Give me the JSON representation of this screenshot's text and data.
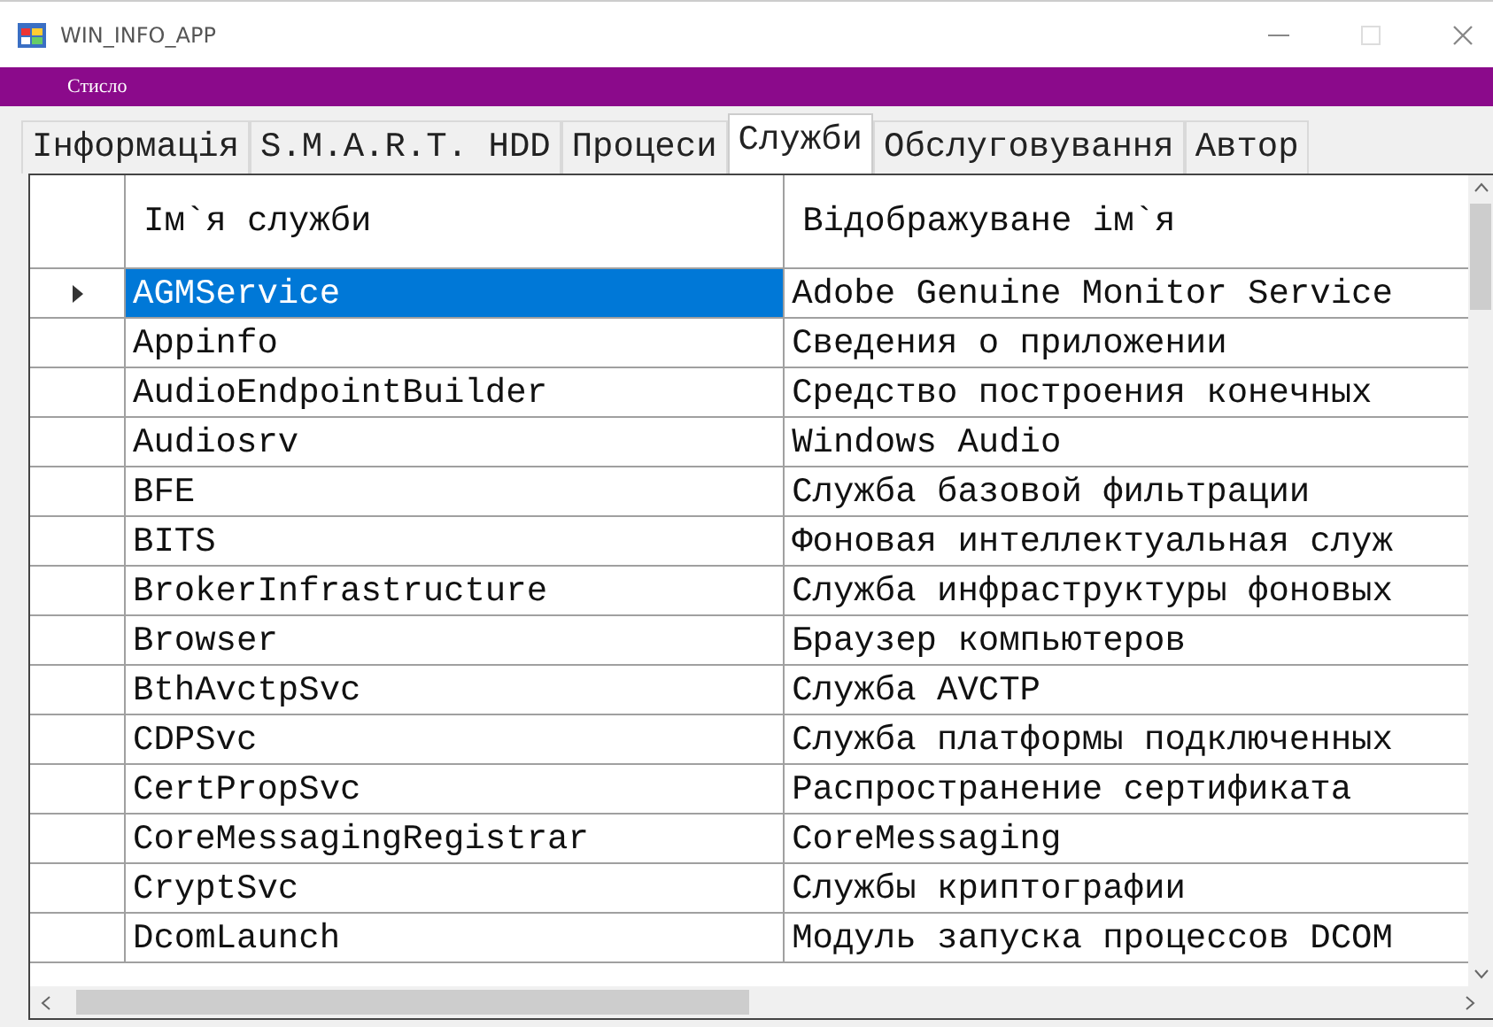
{
  "window": {
    "title": "WIN_INFO_APP"
  },
  "menu": [
    {
      "label": "Стисло"
    }
  ],
  "tabs": [
    {
      "label": "Інформація",
      "selected": false
    },
    {
      "label": "S.M.A.R.T. HDD",
      "selected": false
    },
    {
      "label": "Процеси",
      "selected": false
    },
    {
      "label": "Служби",
      "selected": true
    },
    {
      "label": "Обслуговування",
      "selected": false
    },
    {
      "label": "Автор",
      "selected": false
    }
  ],
  "table": {
    "columns": [
      "Ім`я служби",
      "Відображуване ім`я"
    ],
    "rows": [
      {
        "name": "AGMService",
        "display": "Adobe Genuine Monitor Service",
        "selected": true
      },
      {
        "name": "Appinfo",
        "display": "Сведения о приложении",
        "selected": false
      },
      {
        "name": "AudioEndpointBuilder",
        "display": "Средство построения конечных",
        "selected": false
      },
      {
        "name": "Audiosrv",
        "display": "Windows Audio",
        "selected": false
      },
      {
        "name": "BFE",
        "display": "Служба базовой фильтрации",
        "selected": false
      },
      {
        "name": "BITS",
        "display": "Фоновая интеллектуальная служ",
        "selected": false
      },
      {
        "name": "BrokerInfrastructure",
        "display": "Служба инфраструктуры фоновых",
        "selected": false
      },
      {
        "name": "Browser",
        "display": "Браузер компьютеров",
        "selected": false
      },
      {
        "name": "BthAvctpSvc",
        "display": "Служба AVCTP",
        "selected": false
      },
      {
        "name": "CDPSvc",
        "display": "Служба платформы подключенных",
        "selected": false
      },
      {
        "name": "CertPropSvc",
        "display": "Распространение сертификата",
        "selected": false
      },
      {
        "name": "CoreMessagingRegistrar",
        "display": "CoreMessaging",
        "selected": false
      },
      {
        "name": "CryptSvc",
        "display": "Службы криптографии",
        "selected": false
      },
      {
        "name": "DcomLaunch",
        "display": "Модуль запуска процессов DCOM",
        "selected": false
      }
    ]
  }
}
